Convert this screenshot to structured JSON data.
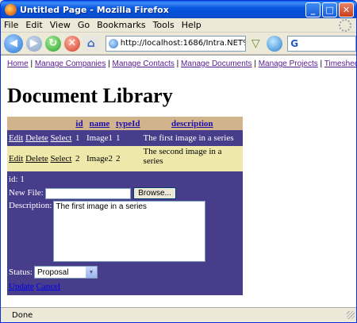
{
  "window": {
    "title": "Untitled Page - Mozilla Firefox"
  },
  "menu": [
    "File",
    "Edit",
    "View",
    "Go",
    "Bookmarks",
    "Tools",
    "Help"
  ],
  "toolbar": {
    "url": "http://localhost:1686/Intra.NET%20",
    "search_glyph": "G"
  },
  "links": [
    "Home",
    "Manage Companies",
    "Manage Contacts",
    "Manage Documents",
    "Manage Projects",
    "Timesheets"
  ],
  "heading": "Document Library",
  "grid": {
    "columns": [
      "id",
      "name",
      "typeId",
      "description"
    ],
    "rows": [
      {
        "actions": [
          "Edit",
          "Delete",
          "Select"
        ],
        "id": "1",
        "name": "Image1",
        "typeId": "1",
        "description": "The first image in a series"
      },
      {
        "actions": [
          "Edit",
          "Delete",
          "Select"
        ],
        "id": "2",
        "name": "Image2",
        "typeId": "2",
        "description": "The second image in a series"
      }
    ]
  },
  "edit": {
    "id_line": "id: 1",
    "file_label": "New File:",
    "browse_label": "Browse...",
    "desc_label": "Description:",
    "desc_value": "The first image in a series",
    "status_label": "Status:",
    "status_value": "Proposal",
    "update_label": "Update",
    "cancel_label": "Cancel"
  },
  "statusbar": {
    "text": "Done"
  }
}
